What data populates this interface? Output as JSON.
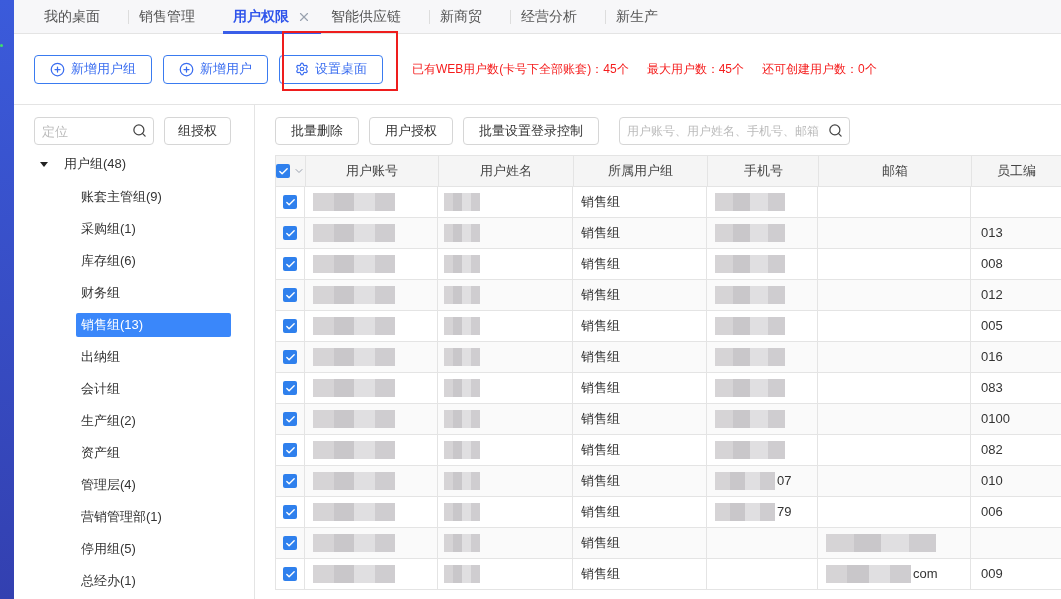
{
  "tabs": [
    {
      "label": "我的桌面",
      "selected": false,
      "closable": false
    },
    {
      "label": "销售管理",
      "selected": false,
      "closable": false
    },
    {
      "label": "用户权限",
      "selected": true,
      "closable": true
    },
    {
      "label": "智能供应链",
      "selected": false,
      "closable": false
    },
    {
      "label": "新商贸",
      "selected": false,
      "closable": false
    },
    {
      "label": "经营分析",
      "selected": false,
      "closable": false
    },
    {
      "label": "新生产",
      "selected": false,
      "closable": false
    }
  ],
  "toolbar": {
    "buttons": [
      {
        "label": "新增用户组",
        "kind": "add",
        "highlighted": false
      },
      {
        "label": "新增用户",
        "kind": "add",
        "highlighted": false
      },
      {
        "label": "设置桌面",
        "kind": "settings",
        "highlighted": true
      }
    ],
    "stats": [
      "已有WEB用户数(卡号下全部账套)：45个",
      "最大用户数：45个",
      "还可创建用户数：0个"
    ]
  },
  "sidebar": {
    "search": {
      "placeholder": "定位"
    },
    "button": "组授权",
    "tree": [
      {
        "label": "用户组(48)",
        "expanded": true,
        "selected": false,
        "children": [
          {
            "label": "账套主管组(9)",
            "selected": false
          },
          {
            "label": "采购组(1)",
            "selected": false
          },
          {
            "label": "库存组(6)",
            "selected": false
          },
          {
            "label": "财务组",
            "selected": false
          },
          {
            "label": "销售组(13)",
            "selected": true
          },
          {
            "label": "出纳组",
            "selected": false
          },
          {
            "label": "会计组",
            "selected": false
          },
          {
            "label": "生产组(2)",
            "selected": false
          },
          {
            "label": "资产组",
            "selected": false
          },
          {
            "label": "管理层(4)",
            "selected": false
          },
          {
            "label": "营销管理部(1)",
            "selected": false
          },
          {
            "label": "停用组(5)",
            "selected": false
          },
          {
            "label": "总经办(1)",
            "selected": false
          }
        ]
      }
    ]
  },
  "actions": [
    "批量删除",
    "用户授权",
    "批量设置登录控制"
  ],
  "table_search": {
    "placeholder": "用户账号、用户姓名、手机号、邮箱"
  },
  "table": {
    "all_checked": true,
    "columns": [
      "用户账号",
      "用户姓名",
      "所属用户组",
      "手机号",
      "邮箱",
      "员工编"
    ],
    "rows": [
      {
        "checked": true,
        "group": "销售组",
        "account_blurred": true,
        "name_blurred": true,
        "phone_blurred": true,
        "email_blurred": false
      },
      {
        "checked": true,
        "group": "销售组",
        "employee_no": "013",
        "account_blurred": true,
        "name_blurred": true,
        "phone_blurred": true,
        "email_blurred": false
      },
      {
        "checked": true,
        "group": "销售组",
        "employee_no": "008",
        "account_blurred": true,
        "name_blurred": true,
        "phone_blurred": true,
        "email_blurred": false
      },
      {
        "checked": true,
        "group": "销售组",
        "employee_no": "012",
        "account_blurred": true,
        "name_blurred": true,
        "phone_blurred": true,
        "email_blurred": false
      },
      {
        "checked": true,
        "group": "销售组",
        "employee_no": "005",
        "account_blurred": true,
        "name_blurred": true,
        "phone_blurred": true,
        "email_blurred": false
      },
      {
        "checked": true,
        "group": "销售组",
        "employee_no": "016",
        "account_blurred": true,
        "name_blurred": true,
        "phone_blurred": true,
        "email_blurred": false
      },
      {
        "checked": true,
        "group": "销售组",
        "employee_no": "083",
        "account_blurred": true,
        "name_blurred": true,
        "phone_blurred": true,
        "email_blurred": false
      },
      {
        "checked": true,
        "group": "销售组",
        "employee_no": "0100",
        "account_blurred": true,
        "name_blurred": true,
        "phone_blurred": true,
        "email_blurred": false
      },
      {
        "checked": true,
        "group": "销售组",
        "employee_no": "082",
        "account_blurred": true,
        "name_blurred": true,
        "phone_blurred": true,
        "email_blurred": false
      },
      {
        "checked": true,
        "group": "销售组",
        "employee_no": "010",
        "phone_tail": "07",
        "account_blurred": true,
        "name_blurred": true,
        "phone_blurred": true,
        "email_blurred": false
      },
      {
        "checked": true,
        "group": "销售组",
        "employee_no": "006",
        "phone_tail": "79",
        "account_blurred": true,
        "name_blurred": true,
        "phone_blurred": true,
        "email_blurred": false
      },
      {
        "checked": true,
        "group": "销售组",
        "account_blurred": true,
        "name_blurred": true,
        "phone_blurred": false,
        "email_blurred": true
      },
      {
        "checked": true,
        "group": "销售组",
        "employee_no": "009",
        "email_tail": "com",
        "account_blurred": true,
        "name_blurred": true,
        "phone_blurred": false,
        "email_blurred": true
      }
    ]
  }
}
